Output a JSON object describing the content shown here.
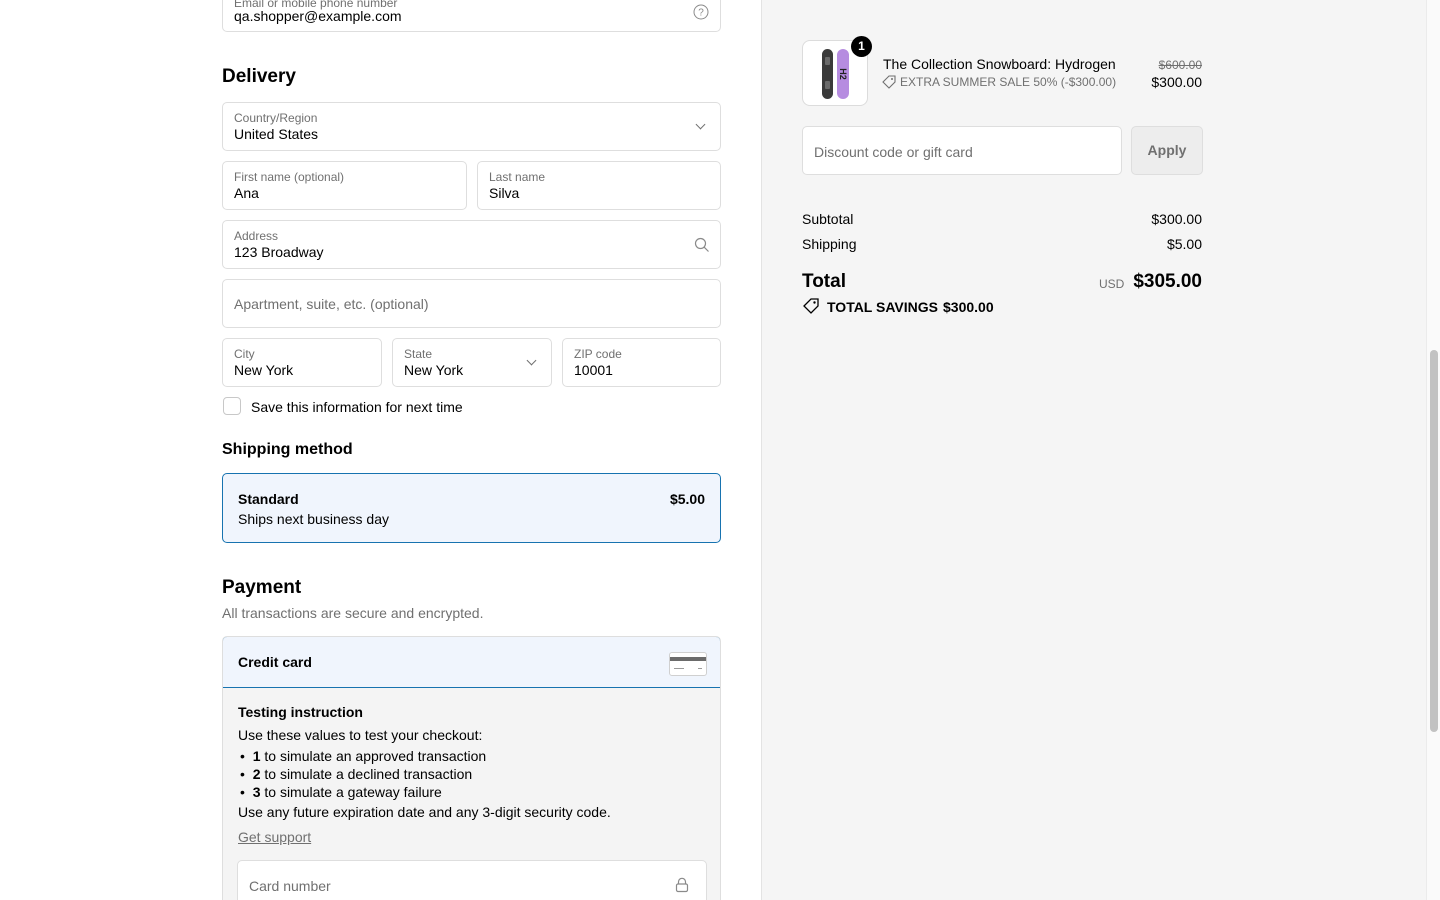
{
  "contact": {
    "email_label": "Email or mobile phone number",
    "email_value": "qa.shopper@example.com"
  },
  "delivery": {
    "heading": "Delivery",
    "country_label": "Country/Region",
    "country_value": "United States",
    "first_name_label": "First name (optional)",
    "first_name_value": "Ana",
    "last_name_label": "Last name",
    "last_name_value": "Silva",
    "address_label": "Address",
    "address_value": "123 Broadway",
    "apartment_placeholder": "Apartment, suite, etc. (optional)",
    "city_label": "City",
    "city_value": "New York",
    "state_label": "State",
    "state_value": "New York",
    "zip_label": "ZIP code",
    "zip_value": "10001",
    "save_info_label": "Save this information for next time"
  },
  "shipping": {
    "heading": "Shipping method",
    "option_name": "Standard",
    "option_desc": "Ships next business day",
    "option_price": "$5.00"
  },
  "payment": {
    "heading": "Payment",
    "subtitle": "All transactions are secure and encrypted.",
    "method_label": "Credit card",
    "instr_title": "Testing instruction",
    "instr_intro": "Use these values to test your checkout:",
    "values": [
      {
        "code": "1",
        "text": " to simulate an approved transaction"
      },
      {
        "code": "2",
        "text": " to simulate a declined transaction"
      },
      {
        "code": "3",
        "text": " to simulate a gateway failure"
      }
    ],
    "instr_footer": "Use any future expiration date and any 3-digit security code.",
    "support_link": "Get support",
    "card_number_placeholder": "Card number"
  },
  "summary": {
    "product_name": "The Collection Snowboard: Hydrogen",
    "product_quantity": "1",
    "discount_text": "EXTRA SUMMER SALE 50% (-$300.00)",
    "original_price": "$600.00",
    "price": "$300.00",
    "discount_placeholder": "Discount code or gift card",
    "apply_label": "Apply",
    "subtotal_label": "Subtotal",
    "subtotal_value": "$300.00",
    "shipping_label": "Shipping",
    "shipping_value": "$5.00",
    "total_label": "Total",
    "currency": "USD",
    "total_value": "$305.00",
    "savings_label": "TOTAL SAVINGS",
    "savings_value": "$300.00"
  },
  "colors": {
    "accent": "#1773b0",
    "selected_bg": "#f0f5fd",
    "summary_bg": "#f5f5f5",
    "muted_text": "#707070"
  }
}
